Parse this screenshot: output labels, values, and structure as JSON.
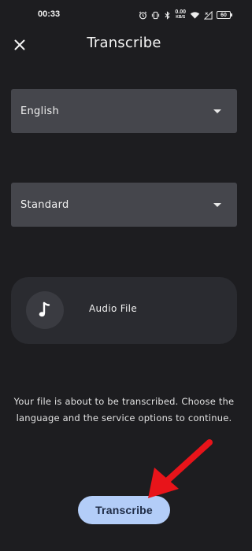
{
  "status_bar": {
    "time": "00:33",
    "net_speed_value": "0.00",
    "net_speed_unit": "KB/S",
    "battery": "60",
    "icons": [
      "alarm-icon",
      "vibrate-icon",
      "bluetooth-icon",
      "wifi-icon",
      "signal-icon"
    ]
  },
  "header": {
    "title": "Transcribe",
    "close_icon": "close-icon"
  },
  "language_select": {
    "value": "English"
  },
  "service_select": {
    "value": "Standard"
  },
  "audio_file": {
    "label": "Audio File",
    "icon": "music-note-icon"
  },
  "info": {
    "text": "Your file is about to be transcribed. Choose the language and the service options to continue."
  },
  "actions": {
    "transcribe_label": "Transcribe"
  },
  "colors": {
    "background": "#1d1d20",
    "dropdown_bg": "#45464c",
    "card_bg": "#2a2b30",
    "button_bg": "#b3cdf8",
    "button_text": "#1e2b45",
    "annotation_arrow": "#e8141a"
  }
}
